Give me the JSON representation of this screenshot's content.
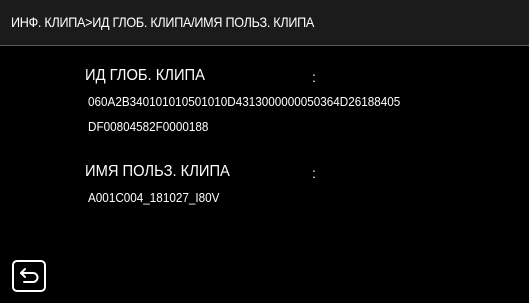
{
  "header": {
    "breadcrumb": "ИНФ. КЛИПА>ИД ГЛОБ. КЛИПА/ИМЯ ПОЛЬЗ. КЛИПА"
  },
  "fields": {
    "global_clip_id": {
      "label": "ИД ГЛОБ. КЛИПА",
      "colon": ":",
      "value_line1": "060A2B340101010501010D4313000000050364D26188405",
      "value_line2": "DF00804582F0000188"
    },
    "user_clip_name": {
      "label": "ИМЯ ПОЛЬЗ. КЛИПА",
      "colon": ":",
      "value": "A001C004_181027_I80V"
    }
  },
  "footer": {
    "back_icon": "return-arrow-icon"
  }
}
